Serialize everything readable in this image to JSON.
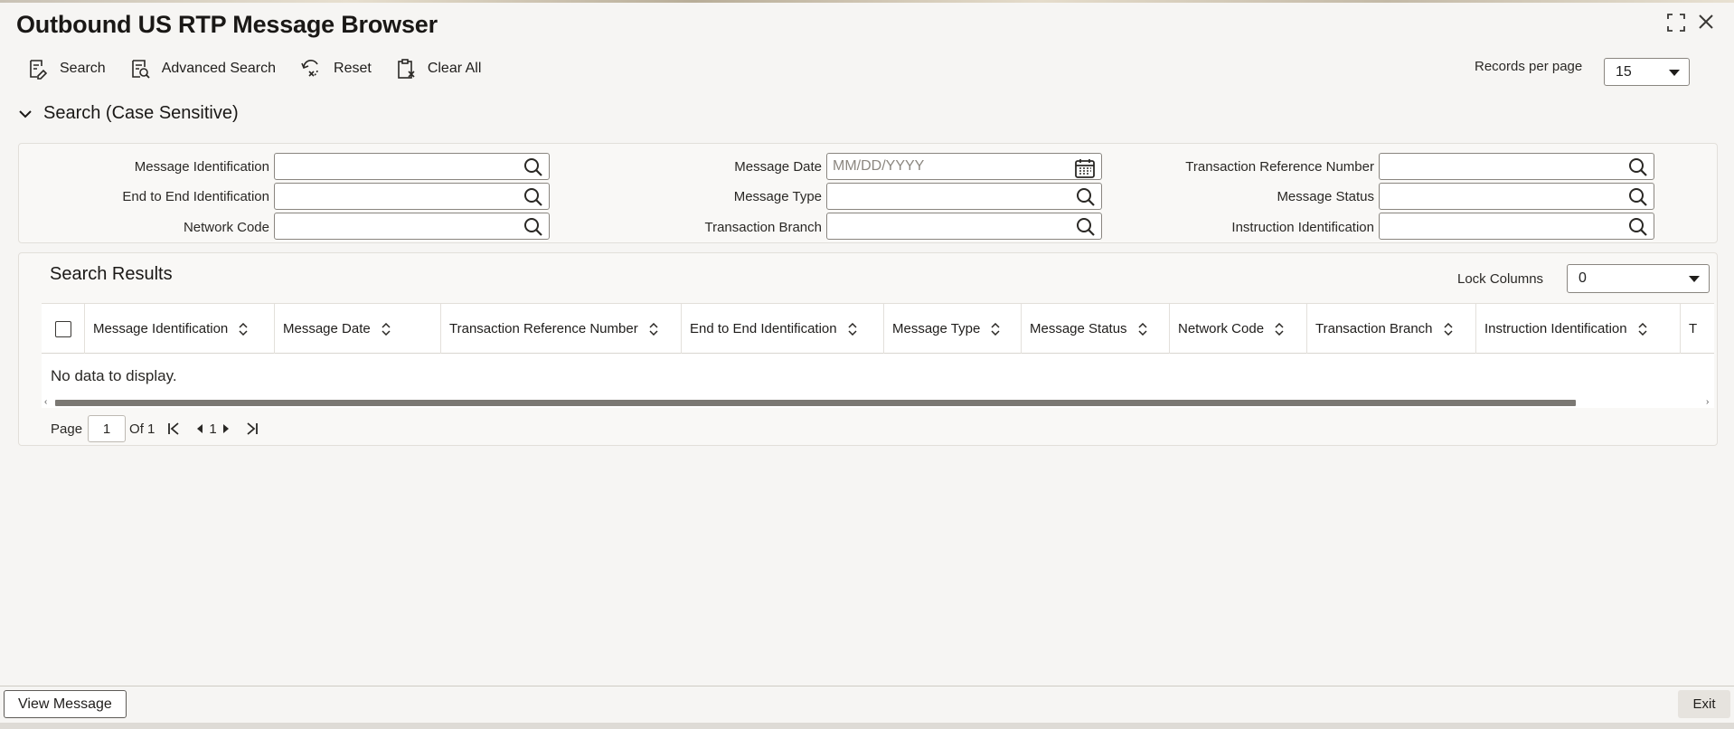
{
  "window": {
    "title": "Outbound US RTP Message Browser",
    "maximize_icon": "maximize-icon",
    "close_icon": "close-icon"
  },
  "toolbar": {
    "search": "Search",
    "advanced_search": "Advanced Search",
    "reset": "Reset",
    "clear_all": "Clear All"
  },
  "records_per_page": {
    "label": "Records per page",
    "value": "15"
  },
  "search_section": {
    "title": "Search (Case Sensitive)",
    "fields": {
      "message_identification": {
        "label": "Message Identification",
        "value": ""
      },
      "end_to_end_identification": {
        "label": "End to End Identification",
        "value": ""
      },
      "network_code": {
        "label": "Network Code",
        "value": ""
      },
      "message_date": {
        "label": "Message Date",
        "placeholder": "MM/DD/YYYY"
      },
      "message_type": {
        "label": "Message Type",
        "value": ""
      },
      "transaction_branch": {
        "label": "Transaction Branch",
        "value": ""
      },
      "transaction_reference_number": {
        "label": "Transaction Reference Number",
        "value": ""
      },
      "message_status": {
        "label": "Message Status",
        "value": ""
      },
      "instruction_identification": {
        "label": "Instruction Identification",
        "value": ""
      }
    }
  },
  "results": {
    "title": "Search Results",
    "lock_columns_label": "Lock Columns",
    "lock_columns_value": "0",
    "columns": [
      "Message Identification",
      "Message Date",
      "Transaction Reference Number",
      "End to End Identification",
      "Message Type",
      "Message Status",
      "Network Code",
      "Transaction Branch",
      "Instruction Identification",
      "T"
    ],
    "empty_text": "No data to display.",
    "pager": {
      "page_label": "Page",
      "current_page": "1",
      "of_label": "Of 1",
      "page_number": "1"
    }
  },
  "footer": {
    "view_message": "View Message",
    "exit": "Exit"
  }
}
